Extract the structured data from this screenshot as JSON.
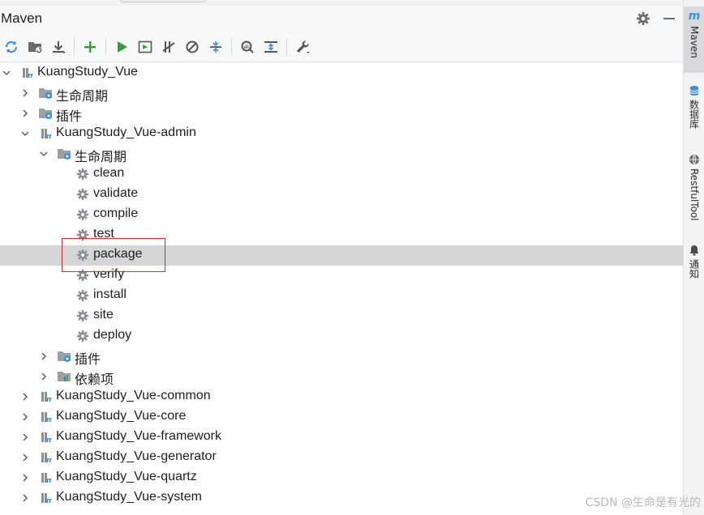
{
  "panel": {
    "title": "Maven",
    "header_icons": [
      "gear-icon",
      "minimize-icon"
    ]
  },
  "toolbar": {
    "buttons": [
      {
        "name": "reload-icon",
        "color": "#3d8fd6"
      },
      {
        "name": "generate-sources-icon",
        "color": "#5a5a5a"
      },
      {
        "name": "download-icon",
        "color": "#5a5a5a"
      },
      {
        "name": "add-icon",
        "color": "#3c9a3c"
      },
      {
        "name": "run-icon",
        "color": "#3c9a3c"
      },
      {
        "name": "run-config-icon",
        "color": "#5a5a5a"
      },
      {
        "name": "toggle-offline-icon",
        "color": "#5a5a5a"
      },
      {
        "name": "skip-tests-icon",
        "color": "#5a5a5a"
      },
      {
        "name": "collapse-all-icon",
        "color": "#5a5a5a"
      },
      {
        "name": "analyze-dependencies-icon",
        "color": "#5a5a5a"
      },
      {
        "name": "show-diagram-icon",
        "color": "#3d8fd6"
      },
      {
        "name": "settings-wrench-icon",
        "color": "#5a5a5a"
      }
    ]
  },
  "tree": [
    {
      "label": "KuangStudy_Vue",
      "depth": 0,
      "icon": "maven-module-icon",
      "state": "expanded"
    },
    {
      "label": "生命周期",
      "depth": 1,
      "icon": "lifecycle-folder-icon",
      "state": "collapsed"
    },
    {
      "label": "插件",
      "depth": 1,
      "icon": "plugins-folder-icon",
      "state": "collapsed"
    },
    {
      "label": "KuangStudy_Vue-admin",
      "depth": 1,
      "icon": "maven-module-icon",
      "state": "expanded"
    },
    {
      "label": "生命周期",
      "depth": 2,
      "icon": "lifecycle-folder-icon",
      "state": "expanded"
    },
    {
      "label": "clean",
      "depth": 3,
      "icon": "goal-gear-icon",
      "state": "leaf"
    },
    {
      "label": "validate",
      "depth": 3,
      "icon": "goal-gear-icon",
      "state": "leaf"
    },
    {
      "label": "compile",
      "depth": 3,
      "icon": "goal-gear-icon",
      "state": "leaf"
    },
    {
      "label": "test",
      "depth": 3,
      "icon": "goal-gear-icon",
      "state": "leaf"
    },
    {
      "label": "package",
      "depth": 3,
      "icon": "goal-gear-icon",
      "state": "leaf",
      "selected": true
    },
    {
      "label": "verify",
      "depth": 3,
      "icon": "goal-gear-icon",
      "state": "leaf"
    },
    {
      "label": "install",
      "depth": 3,
      "icon": "goal-gear-icon",
      "state": "leaf"
    },
    {
      "label": "site",
      "depth": 3,
      "icon": "goal-gear-icon",
      "state": "leaf"
    },
    {
      "label": "deploy",
      "depth": 3,
      "icon": "goal-gear-icon",
      "state": "leaf"
    },
    {
      "label": "插件",
      "depth": 2,
      "icon": "plugins-folder-icon",
      "state": "collapsed"
    },
    {
      "label": "依赖项",
      "depth": 2,
      "icon": "dependencies-icon",
      "state": "collapsed"
    },
    {
      "label": "KuangStudy_Vue-common",
      "depth": 1,
      "icon": "maven-module-icon",
      "state": "collapsed"
    },
    {
      "label": "KuangStudy_Vue-core",
      "depth": 1,
      "icon": "maven-module-icon",
      "state": "collapsed"
    },
    {
      "label": "KuangStudy_Vue-framework",
      "depth": 1,
      "icon": "maven-module-icon",
      "state": "collapsed"
    },
    {
      "label": "KuangStudy_Vue-generator",
      "depth": 1,
      "icon": "maven-module-icon",
      "state": "collapsed"
    },
    {
      "label": "KuangStudy_Vue-quartz",
      "depth": 1,
      "icon": "maven-module-icon",
      "state": "collapsed"
    },
    {
      "label": "KuangStudy_Vue-system",
      "depth": 1,
      "icon": "maven-module-icon",
      "state": "collapsed"
    }
  ],
  "right_sidebar": {
    "items": [
      {
        "label": "Maven",
        "icon": "maven-icon",
        "active": true
      },
      {
        "label": "数据库",
        "icon": "database-icon",
        "active": false
      },
      {
        "label": "RestfulTool",
        "icon": "globe-icon",
        "active": false
      },
      {
        "label": "通知",
        "icon": "bell-icon",
        "active": false
      }
    ]
  },
  "watermark": "CSDN @生命是有光的",
  "colors": {
    "selection": "#d5d5d5",
    "highlight_border": "#d9292b",
    "accent_blue": "#3d8fd6",
    "accent_green": "#3c9a3c"
  }
}
